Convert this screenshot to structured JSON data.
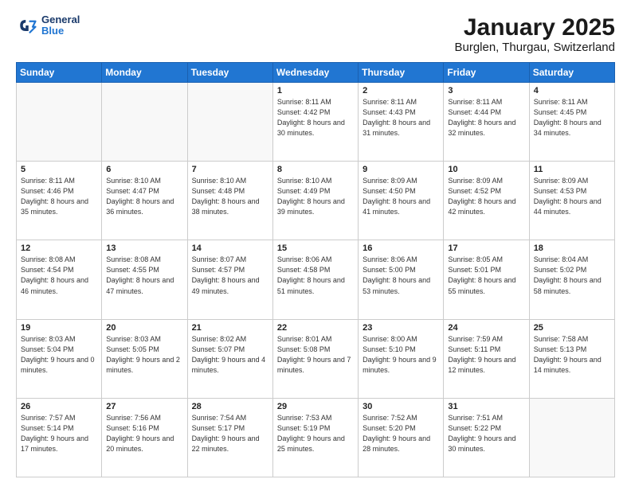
{
  "logo": {
    "line1": "General",
    "line2": "Blue"
  },
  "title": "January 2025",
  "subtitle": "Burglen, Thurgau, Switzerland",
  "days_of_week": [
    "Sunday",
    "Monday",
    "Tuesday",
    "Wednesday",
    "Thursday",
    "Friday",
    "Saturday"
  ],
  "weeks": [
    [
      {
        "day": "",
        "sunrise": "",
        "sunset": "",
        "daylight": ""
      },
      {
        "day": "",
        "sunrise": "",
        "sunset": "",
        "daylight": ""
      },
      {
        "day": "",
        "sunrise": "",
        "sunset": "",
        "daylight": ""
      },
      {
        "day": "1",
        "sunrise": "Sunrise: 8:11 AM",
        "sunset": "Sunset: 4:42 PM",
        "daylight": "Daylight: 8 hours and 30 minutes."
      },
      {
        "day": "2",
        "sunrise": "Sunrise: 8:11 AM",
        "sunset": "Sunset: 4:43 PM",
        "daylight": "Daylight: 8 hours and 31 minutes."
      },
      {
        "day": "3",
        "sunrise": "Sunrise: 8:11 AM",
        "sunset": "Sunset: 4:44 PM",
        "daylight": "Daylight: 8 hours and 32 minutes."
      },
      {
        "day": "4",
        "sunrise": "Sunrise: 8:11 AM",
        "sunset": "Sunset: 4:45 PM",
        "daylight": "Daylight: 8 hours and 34 minutes."
      }
    ],
    [
      {
        "day": "5",
        "sunrise": "Sunrise: 8:11 AM",
        "sunset": "Sunset: 4:46 PM",
        "daylight": "Daylight: 8 hours and 35 minutes."
      },
      {
        "day": "6",
        "sunrise": "Sunrise: 8:10 AM",
        "sunset": "Sunset: 4:47 PM",
        "daylight": "Daylight: 8 hours and 36 minutes."
      },
      {
        "day": "7",
        "sunrise": "Sunrise: 8:10 AM",
        "sunset": "Sunset: 4:48 PM",
        "daylight": "Daylight: 8 hours and 38 minutes."
      },
      {
        "day": "8",
        "sunrise": "Sunrise: 8:10 AM",
        "sunset": "Sunset: 4:49 PM",
        "daylight": "Daylight: 8 hours and 39 minutes."
      },
      {
        "day": "9",
        "sunrise": "Sunrise: 8:09 AM",
        "sunset": "Sunset: 4:50 PM",
        "daylight": "Daylight: 8 hours and 41 minutes."
      },
      {
        "day": "10",
        "sunrise": "Sunrise: 8:09 AM",
        "sunset": "Sunset: 4:52 PM",
        "daylight": "Daylight: 8 hours and 42 minutes."
      },
      {
        "day": "11",
        "sunrise": "Sunrise: 8:09 AM",
        "sunset": "Sunset: 4:53 PM",
        "daylight": "Daylight: 8 hours and 44 minutes."
      }
    ],
    [
      {
        "day": "12",
        "sunrise": "Sunrise: 8:08 AM",
        "sunset": "Sunset: 4:54 PM",
        "daylight": "Daylight: 8 hours and 46 minutes."
      },
      {
        "day": "13",
        "sunrise": "Sunrise: 8:08 AM",
        "sunset": "Sunset: 4:55 PM",
        "daylight": "Daylight: 8 hours and 47 minutes."
      },
      {
        "day": "14",
        "sunrise": "Sunrise: 8:07 AM",
        "sunset": "Sunset: 4:57 PM",
        "daylight": "Daylight: 8 hours and 49 minutes."
      },
      {
        "day": "15",
        "sunrise": "Sunrise: 8:06 AM",
        "sunset": "Sunset: 4:58 PM",
        "daylight": "Daylight: 8 hours and 51 minutes."
      },
      {
        "day": "16",
        "sunrise": "Sunrise: 8:06 AM",
        "sunset": "Sunset: 5:00 PM",
        "daylight": "Daylight: 8 hours and 53 minutes."
      },
      {
        "day": "17",
        "sunrise": "Sunrise: 8:05 AM",
        "sunset": "Sunset: 5:01 PM",
        "daylight": "Daylight: 8 hours and 55 minutes."
      },
      {
        "day": "18",
        "sunrise": "Sunrise: 8:04 AM",
        "sunset": "Sunset: 5:02 PM",
        "daylight": "Daylight: 8 hours and 58 minutes."
      }
    ],
    [
      {
        "day": "19",
        "sunrise": "Sunrise: 8:03 AM",
        "sunset": "Sunset: 5:04 PM",
        "daylight": "Daylight: 9 hours and 0 minutes."
      },
      {
        "day": "20",
        "sunrise": "Sunrise: 8:03 AM",
        "sunset": "Sunset: 5:05 PM",
        "daylight": "Daylight: 9 hours and 2 minutes."
      },
      {
        "day": "21",
        "sunrise": "Sunrise: 8:02 AM",
        "sunset": "Sunset: 5:07 PM",
        "daylight": "Daylight: 9 hours and 4 minutes."
      },
      {
        "day": "22",
        "sunrise": "Sunrise: 8:01 AM",
        "sunset": "Sunset: 5:08 PM",
        "daylight": "Daylight: 9 hours and 7 minutes."
      },
      {
        "day": "23",
        "sunrise": "Sunrise: 8:00 AM",
        "sunset": "Sunset: 5:10 PM",
        "daylight": "Daylight: 9 hours and 9 minutes."
      },
      {
        "day": "24",
        "sunrise": "Sunrise: 7:59 AM",
        "sunset": "Sunset: 5:11 PM",
        "daylight": "Daylight: 9 hours and 12 minutes."
      },
      {
        "day": "25",
        "sunrise": "Sunrise: 7:58 AM",
        "sunset": "Sunset: 5:13 PM",
        "daylight": "Daylight: 9 hours and 14 minutes."
      }
    ],
    [
      {
        "day": "26",
        "sunrise": "Sunrise: 7:57 AM",
        "sunset": "Sunset: 5:14 PM",
        "daylight": "Daylight: 9 hours and 17 minutes."
      },
      {
        "day": "27",
        "sunrise": "Sunrise: 7:56 AM",
        "sunset": "Sunset: 5:16 PM",
        "daylight": "Daylight: 9 hours and 20 minutes."
      },
      {
        "day": "28",
        "sunrise": "Sunrise: 7:54 AM",
        "sunset": "Sunset: 5:17 PM",
        "daylight": "Daylight: 9 hours and 22 minutes."
      },
      {
        "day": "29",
        "sunrise": "Sunrise: 7:53 AM",
        "sunset": "Sunset: 5:19 PM",
        "daylight": "Daylight: 9 hours and 25 minutes."
      },
      {
        "day": "30",
        "sunrise": "Sunrise: 7:52 AM",
        "sunset": "Sunset: 5:20 PM",
        "daylight": "Daylight: 9 hours and 28 minutes."
      },
      {
        "day": "31",
        "sunrise": "Sunrise: 7:51 AM",
        "sunset": "Sunset: 5:22 PM",
        "daylight": "Daylight: 9 hours and 30 minutes."
      },
      {
        "day": "",
        "sunrise": "",
        "sunset": "",
        "daylight": ""
      }
    ]
  ]
}
